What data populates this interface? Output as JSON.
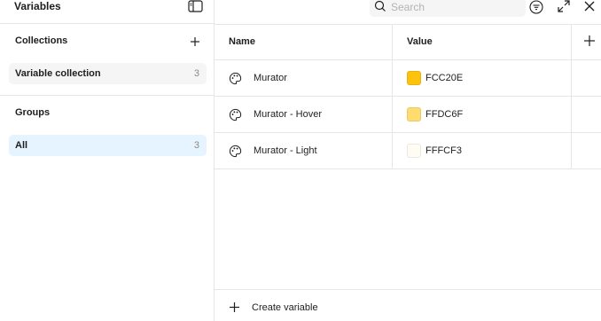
{
  "app": {
    "title": "Variables"
  },
  "sidebar": {
    "collections_title": "Collections",
    "collections": [
      {
        "label": "Variable collection",
        "count": "3"
      }
    ],
    "groups_title": "Groups",
    "groups": [
      {
        "label": "All",
        "count": "3"
      }
    ]
  },
  "search": {
    "placeholder": "Search",
    "value": ""
  },
  "table": {
    "headers": {
      "name": "Name",
      "value": "Value"
    },
    "rows": [
      {
        "name": "Murator",
        "value": "FCC20E",
        "color": "#FCC20E"
      },
      {
        "name": "Murator - Hover",
        "value": "FFDC6F",
        "color": "#FFDC6F"
      },
      {
        "name": "Murator - Light",
        "value": "FFFCF3",
        "color": "#FFFCF3"
      }
    ]
  },
  "footer": {
    "create_label": "Create variable"
  },
  "colors": {
    "selected_group_bg": "#E5F4FF",
    "selected_collection_bg": "#F5F5F5",
    "border": "#E6E6E6"
  },
  "icons": {
    "sidebar_toggle": "sidebar-toggle-icon",
    "add": "plus-icon",
    "search": "search-icon",
    "filter": "filter-icon",
    "expand": "expand-icon",
    "close": "close-icon",
    "variable": "palette-icon"
  }
}
